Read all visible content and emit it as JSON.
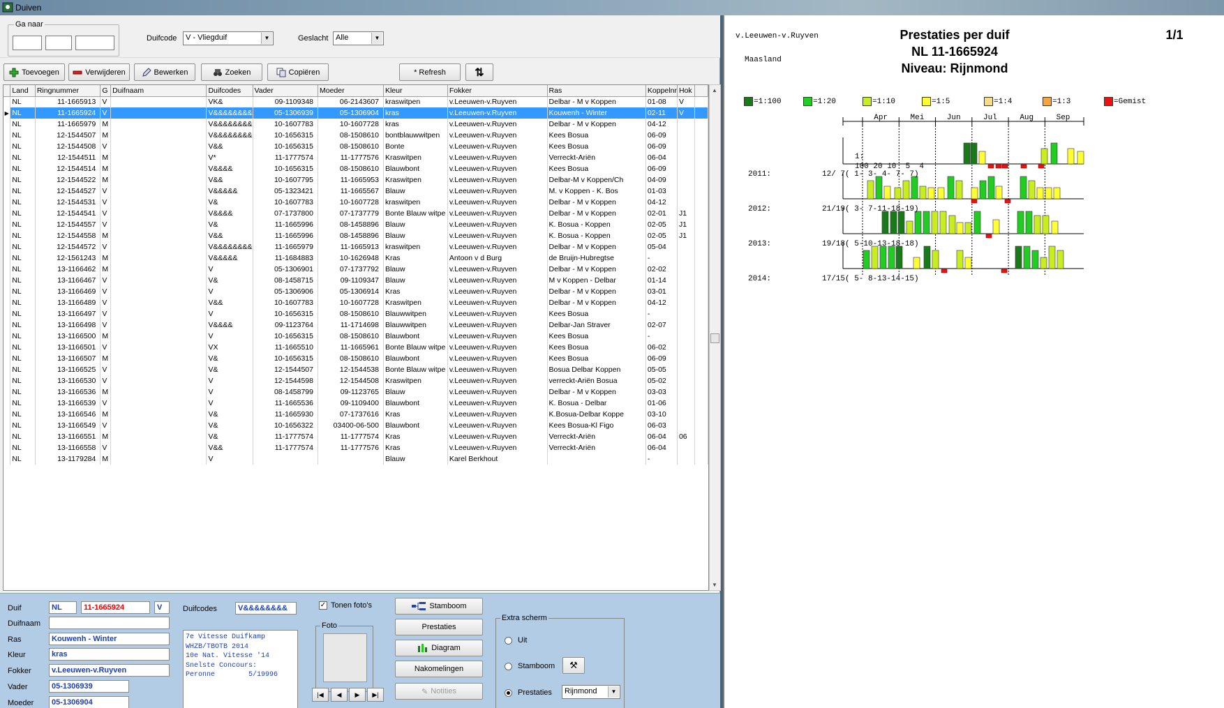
{
  "window": {
    "title": "Duiven"
  },
  "filters": {
    "ga_naar_label": "Ga naar",
    "duifcode_label": "Duifcode",
    "duifcode_value": "V - Vliegduif",
    "geslacht_label": "Geslacht",
    "geslacht_value": "Alle"
  },
  "toolbar": {
    "toevoegen": "Toevoegen",
    "verwijderen": "Verwijderen",
    "bewerken": "Bewerken",
    "zoeken": "Zoeken",
    "copieren": "Copiëren",
    "refresh": "* Refresh"
  },
  "grid": {
    "columns": [
      "Land",
      "Ringnummer",
      "G",
      "Duifnaam",
      "Duifcodes",
      "Vader",
      "Moeder",
      "Kleur",
      "Fokker",
      "Ras",
      "Koppelnr",
      "Hok"
    ],
    "selected_index": 1,
    "rows": [
      [
        "NL",
        "11-1665913",
        "V",
        "",
        "VK&",
        "09-1109348",
        "06-2143607",
        "kraswitpen",
        "v.Leeuwen-v.Ruyven",
        "Delbar - M v Koppen",
        "01-08",
        "V"
      ],
      [
        "NL",
        "11-1665924",
        "V",
        "",
        "V&&&&&&&&",
        "05-1306939",
        "05-1306904",
        "kras",
        "v.Leeuwen-v.Ruyven",
        "Kouwenh - Winter",
        "02-11",
        "V"
      ],
      [
        "NL",
        "11-1665979",
        "M",
        "",
        "V&&&&&&&&",
        "10-1607783",
        "10-1607728",
        "kras",
        "v.Leeuwen-v.Ruyven",
        "Delbar - M v Koppen",
        "04-12",
        ""
      ],
      [
        "NL",
        "12-1544507",
        "M",
        "",
        "V&&&&&&&&",
        "10-1656315",
        "08-1508610",
        "bontblauwwitpen",
        "v.Leeuwen-v.Ruyven",
        "Kees Bosua",
        "06-09",
        ""
      ],
      [
        "NL",
        "12-1544508",
        "V",
        "",
        "V&&",
        "10-1656315",
        "08-1508610",
        "Bonte",
        "v.Leeuwen-v.Ruyven",
        "Kees Bosua",
        "06-09",
        ""
      ],
      [
        "NL",
        "12-1544511",
        "M",
        "",
        "V*",
        "11-1777574",
        "11-1777576",
        "Kraswitpen",
        "v.Leeuwen-v.Ruyven",
        "Verreckt-Ariën",
        "06-04",
        ""
      ],
      [
        "NL",
        "12-1544514",
        "M",
        "",
        "V&&&&",
        "10-1656315",
        "08-1508610",
        "Blauwbont",
        "v.Leeuwen-v.Ruyven",
        "Kees Bosua",
        "06-09",
        ""
      ],
      [
        "NL",
        "12-1544522",
        "M",
        "",
        "V&&",
        "10-1607795",
        "11-1665953",
        "Kraswitpen",
        "v.Leeuwen-v.Ruyven",
        "Delbar-M v Koppen/Ch",
        "04-09",
        ""
      ],
      [
        "NL",
        "12-1544527",
        "V",
        "",
        "V&&&&&",
        "05-1323421",
        "11-1665567",
        "Blauw",
        "v.Leeuwen-v.Ruyven",
        "M. v Koppen - K. Bos",
        "01-03",
        ""
      ],
      [
        "NL",
        "12-1544531",
        "V",
        "",
        "V&",
        "10-1607783",
        "10-1607728",
        "kraswitpen",
        "v.Leeuwen-v.Ruyven",
        "Delbar - M v Koppen",
        "04-12",
        ""
      ],
      [
        "NL",
        "12-1544541",
        "V",
        "",
        "V&&&&",
        "07-1737800",
        "07-1737779",
        "Bonte Blauw witpe",
        "v.Leeuwen-v.Ruyven",
        "Delbar - M v Koppen",
        "02-01",
        "J1"
      ],
      [
        "NL",
        "12-1544557",
        "V",
        "",
        "V&",
        "11-1665996",
        "08-1458896",
        "Blauw",
        "v.Leeuwen-v.Ruyven",
        "K. Bosua -  Koppen",
        "02-05",
        "J1"
      ],
      [
        "NL",
        "12-1544558",
        "M",
        "",
        "V&&",
        "11-1665996",
        "08-1458896",
        "Blauw",
        "v.Leeuwen-v.Ruyven",
        "K. Bosua -  Koppen",
        "02-05",
        "J1"
      ],
      [
        "NL",
        "12-1544572",
        "V",
        "",
        "V&&&&&&&&",
        "11-1665979",
        "11-1665913",
        "kraswitpen",
        "v.Leeuwen-v.Ruyven",
        "Delbar - M v Koppen",
        "05-04",
        ""
      ],
      [
        "NL",
        "12-1561243",
        "M",
        "",
        "V&&&&&",
        "11-1684883",
        "10-1626948",
        "Kras",
        "Antoon v d Burg",
        "de Bruijn-Hubregtse",
        "-",
        ""
      ],
      [
        "NL",
        "13-1166462",
        "M",
        "",
        "V",
        "05-1306901",
        "07-1737792",
        "Blauw",
        "v.Leeuwen-v.Ruyven",
        "Delbar - M v Koppen",
        "02-02",
        ""
      ],
      [
        "NL",
        "13-1166467",
        "V",
        "",
        "V&",
        "08-1458715",
        "09-1109347",
        "Blauw",
        "v.Leeuwen-v.Ruyven",
        "M v Koppen - Delbar",
        "01-14",
        ""
      ],
      [
        "NL",
        "13-1166469",
        "V",
        "",
        "V",
        "05-1306906",
        "05-1306914",
        "Kras",
        "v.Leeuwen-v.Ruyven",
        "Delbar - M v Koppen",
        "03-01",
        ""
      ],
      [
        "NL",
        "13-1166489",
        "V",
        "",
        "V&&",
        "10-1607783",
        "10-1607728",
        "Kraswitpen",
        "v.Leeuwen-v.Ruyven",
        "Delbar - M v Koppen",
        "04-12",
        ""
      ],
      [
        "NL",
        "13-1166497",
        "V",
        "",
        "V",
        "10-1656315",
        "08-1508610",
        "Blauwwitpen",
        "v.Leeuwen-v.Ruyven",
        "Kees Bosua",
        "-",
        ""
      ],
      [
        "NL",
        "13-1166498",
        "V",
        "",
        "V&&&&",
        "09-1123764",
        "11-1714698",
        "Blauwwitpen",
        "v.Leeuwen-v.Ruyven",
        "Delbar-Jan Straver",
        "02-07",
        ""
      ],
      [
        "NL",
        "13-1166500",
        "M",
        "",
        "V",
        "10-1656315",
        "08-1508610",
        "Blauwbont",
        "v.Leeuwen-v.Ruyven",
        "Kees Bosua",
        "-",
        ""
      ],
      [
        "NL",
        "13-1166501",
        "V",
        "",
        "VX",
        "11-1665510",
        "11-1665961",
        "Bonte Blauw witpe",
        "v.Leeuwen-v.Ruyven",
        "Kees Bosua",
        "06-02",
        ""
      ],
      [
        "NL",
        "13-1166507",
        "M",
        "",
        "V&",
        "10-1656315",
        "08-1508610",
        "Blauwbont",
        "v.Leeuwen-v.Ruyven",
        "Kees Bosua",
        "06-09",
        ""
      ],
      [
        "NL",
        "13-1166525",
        "V",
        "",
        "V&",
        "12-1544507",
        "12-1544538",
        "Bonte Blauw witpe",
        "v.Leeuwen-v.Ruyven",
        "Bosua Delbar Koppen",
        "05-05",
        ""
      ],
      [
        "NL",
        "13-1166530",
        "V",
        "",
        "V",
        "12-1544598",
        "12-1544508",
        "Kraswitpen",
        "v.Leeuwen-v.Ruyven",
        "verreckt-Ariën Bosua",
        "05-02",
        ""
      ],
      [
        "NL",
        "13-1166536",
        "M",
        "",
        "V",
        "08-1458799",
        "09-1123765",
        "Blauw",
        "v.Leeuwen-v.Ruyven",
        "Delbar - M v Koppen",
        "03-03",
        ""
      ],
      [
        "NL",
        "13-1166539",
        "V",
        "",
        "V",
        "11-1665536",
        "09-1109400",
        "Blauwbont",
        "v.Leeuwen-v.Ruyven",
        "K. Bosua - Delbar",
        "01-06",
        ""
      ],
      [
        "NL",
        "13-1166546",
        "M",
        "",
        "V&",
        "11-1665930",
        "07-1737616",
        "Kras",
        "v.Leeuwen-v.Ruyven",
        "K.Bosua-Delbar Koppe",
        "03-10",
        ""
      ],
      [
        "NL",
        "13-1166549",
        "V",
        "",
        "V&",
        "10-1656322",
        "03400-06-500",
        "Blauwbont",
        "v.Leeuwen-v.Ruyven",
        "Kees Bosua-Kl Figo",
        "06-03",
        ""
      ],
      [
        "NL",
        "13-1166551",
        "M",
        "",
        "V&",
        "11-1777574",
        "11-1777574",
        "Kras",
        "v.Leeuwen-v.Ruyven",
        "Verreckt-Ariën",
        "06-04",
        "06"
      ],
      [
        "NL",
        "13-1166558",
        "V",
        "",
        "V&&",
        "11-1777574",
        "11-1777576",
        "Kras",
        "v.Leeuwen-v.Ruyven",
        "Verreckt-Ariën",
        "06-04",
        ""
      ],
      [
        "NL",
        "13-1179284",
        "M",
        "",
        "V",
        "",
        "",
        "Blauw",
        "Karel Berkhout",
        "",
        "-",
        ""
      ]
    ]
  },
  "detail": {
    "duif_label": "Duif",
    "duif_land": "NL",
    "duif_ring": "11-1665924",
    "duif_geslacht": "V",
    "duifnaam_label": "Duifnaam",
    "duifnaam_value": "",
    "ras_label": "Ras",
    "ras_value": "Kouwenh - Winter",
    "kleur_label": "Kleur",
    "kleur_value": "kras",
    "fokker_label": "Fokker",
    "fokker_value": "v.Leeuwen-v.Ruyven",
    "vader_label": "Vader",
    "vader_value": "05-1306939",
    "moeder_label": "Moeder",
    "moeder_value": "05-1306904",
    "duifcodes_label": "Duifcodes",
    "duifcodes_value": "V&&&&&&&&",
    "memo": "7e Vitesse Duifkamp\nWHZB/TBOTB 2014\n10e Nat. Vitesse '14\nSnelste Concours:\nPeronne        5/19996",
    "tonen_fotos_label": "Tonen foto's",
    "foto_label": "Foto",
    "stamboom_btn": "Stamboom",
    "prestaties_btn": "Prestaties",
    "diagram_btn": "Diagram",
    "nakomelingen_btn": "Nakomelingen",
    "notities_btn": "Notities",
    "extra_scherm_label": "Extra scherm",
    "opt_uit": "Uit",
    "opt_stamboom": "Stamboom",
    "opt_prestaties": "Prestaties",
    "prestaties_combo": "Rijnmond"
  },
  "report": {
    "owner": "v.Leeuwen-v.Ruyven",
    "place": "Maasland",
    "title1": "Prestaties per duif",
    "title2": "NL 11-1665924",
    "title3": "Niveau: Rijnmond",
    "page": "1/1",
    "legend": [
      {
        "label": "=1:100",
        "color": "#1a7a1a"
      },
      {
        "label": "=1:20",
        "color": "#22cc22"
      },
      {
        "label": "=1:10",
        "color": "#c8ee22"
      },
      {
        "label": "=1:5",
        "color": "#ffff33"
      },
      {
        "label": "=1:4",
        "color": "#f8dc88"
      },
      {
        "label": "=1:3",
        "color": "#f7a43c"
      },
      {
        "label": "=Gemist",
        "color": "#ee1111"
      }
    ],
    "months": [
      "Apr",
      "Mei",
      "Jun",
      "Jul",
      "Aug",
      "Sep"
    ],
    "header_line1": "1:",
    "header_line2": "100 20 10  5  4",
    "years": [
      {
        "label": "2011:",
        "stats": "12/ 7( 1- 3- 4- 7- 7)"
      },
      {
        "label": "2012:",
        "stats": "21/19( 3- 7-11-18-19)"
      },
      {
        "label": "2013:",
        "stats": "19/18( 5-10-13-18-18)"
      },
      {
        "label": "2014:",
        "stats": "17/15( 5- 8-13-14-15)"
      }
    ]
  }
}
